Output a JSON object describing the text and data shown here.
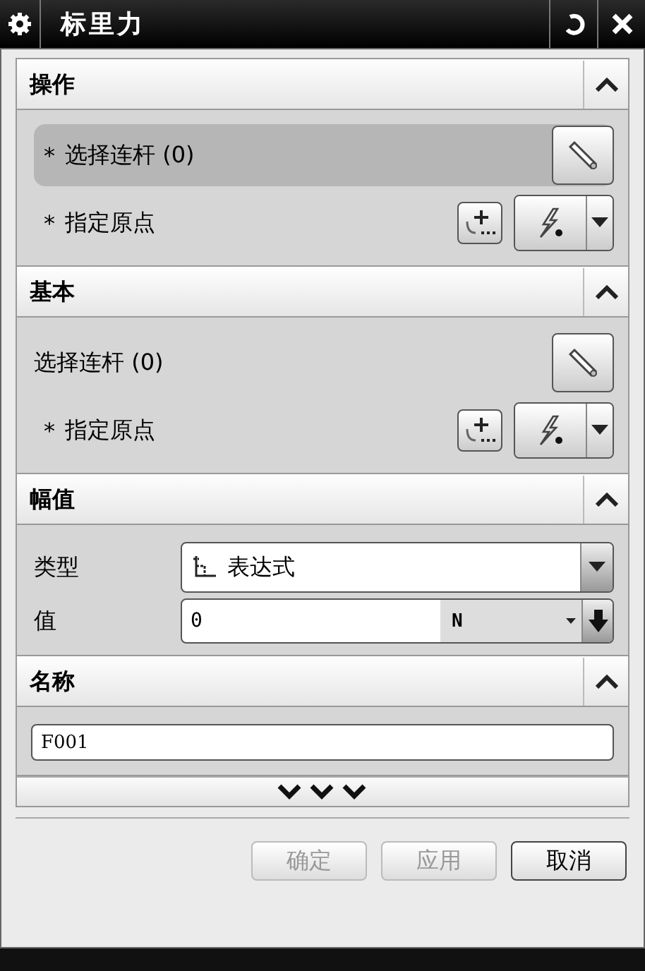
{
  "window": {
    "title": "标里力"
  },
  "sections": [
    {
      "title": "操作",
      "expanded": true,
      "rows": [
        {
          "kind": "select",
          "marker": "*",
          "label": "选择连杆 (0)",
          "highlighted": true
        },
        {
          "kind": "point",
          "marker": "*",
          "label": "指定原点",
          "highlighted": false
        }
      ]
    },
    {
      "title": "基本",
      "expanded": true,
      "rows": [
        {
          "kind": "select",
          "label": "选择连杆 (0)",
          "highlighted": false
        },
        {
          "kind": "point",
          "marker": "*",
          "label": "指定原点",
          "highlighted": false
        }
      ]
    },
    {
      "title": "幅值",
      "expanded": true,
      "rows": [
        {
          "kind": "dropdown",
          "label": "类型",
          "value": "表达式"
        },
        {
          "kind": "value",
          "label": "值",
          "value": "0",
          "unit": "N"
        }
      ]
    },
    {
      "title": "名称",
      "expanded": true,
      "rows": [
        {
          "kind": "text",
          "value": "F001"
        }
      ]
    }
  ],
  "buttons": [
    {
      "label": "确定",
      "disabled": true
    },
    {
      "label": "应用",
      "disabled": true
    },
    {
      "label": "取消",
      "disabled": false
    }
  ]
}
